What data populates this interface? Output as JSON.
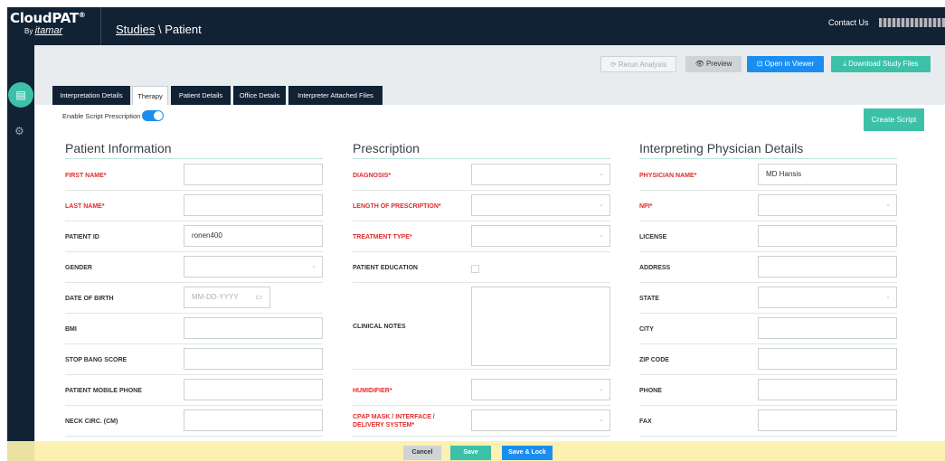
{
  "header": {
    "brand": "CloudPAT",
    "brand_reg": "®",
    "brand_by": "By",
    "brand_company": "itamar",
    "breadcrumb_link": "Studies",
    "breadcrumb_current": " \\ Patient",
    "contact": "Contact Us"
  },
  "actions": {
    "rerun": "⟳ Rerun Analysis",
    "preview": "👁 Preview",
    "open_viewer": "⊡ Open in Viewer",
    "download": "⤓ Download Study Files"
  },
  "tabs": [
    {
      "label": "Interpretation Details",
      "active": false
    },
    {
      "label": "Therapy",
      "active": true
    },
    {
      "label": "Patient Details",
      "active": false
    },
    {
      "label": "Office Details",
      "active": false
    },
    {
      "label": "Interpreter Attached Files",
      "active": false
    }
  ],
  "script": {
    "label": "Enable Script Prescription",
    "enabled": true,
    "create_label": "Create Script"
  },
  "patient": {
    "title": "Patient Information",
    "first_name": {
      "label": "FIRST NAME*",
      "value": ""
    },
    "last_name": {
      "label": "LAST NAME*",
      "value": ""
    },
    "patient_id": {
      "label": "PATIENT ID",
      "value": "ronen400"
    },
    "gender": {
      "label": "GENDER",
      "value": ""
    },
    "dob": {
      "label": "DATE OF BIRTH",
      "placeholder": "MM-DD-YYYY"
    },
    "bmi": {
      "label": "BMI",
      "value": ""
    },
    "stop_bang": {
      "label": "STOP BANG SCORE",
      "value": ""
    },
    "mobile": {
      "label": "PATIENT MOBILE PHONE",
      "value": ""
    },
    "neck": {
      "label": "NECK CIRC. (CM)",
      "value": ""
    }
  },
  "prescription": {
    "title": "Prescription",
    "diagnosis": {
      "label": "DIAGNOSIS*",
      "value": ""
    },
    "length": {
      "label": "LENGTH OF PRESCRIPTION*",
      "value": ""
    },
    "treatment": {
      "label": "TREATMENT TYPE*",
      "value": ""
    },
    "education": {
      "label": "PATIENT EDUCATION",
      "checked": false
    },
    "notes": {
      "label": "CLINICAL NOTES",
      "value": ""
    },
    "humidifier": {
      "label": "HUMIDIFIER*",
      "value": ""
    },
    "cpap_line1": "CPAP MASK / INTERFACE /",
    "cpap_line2": "DELIVERY SYSTEM*"
  },
  "physician": {
    "title": "Interpreting Physician Details",
    "name": {
      "label": "PHYSICIAN NAME*",
      "value": "MD Hansis"
    },
    "npi": {
      "label": "NPI*",
      "value": ""
    },
    "license": {
      "label": "LICENSE",
      "value": ""
    },
    "address": {
      "label": "ADDRESS",
      "value": ""
    },
    "state": {
      "label": "STATE",
      "value": ""
    },
    "city": {
      "label": "CITY",
      "value": ""
    },
    "zip": {
      "label": "ZIP CODE",
      "value": ""
    },
    "phone": {
      "label": "PHONE",
      "value": ""
    },
    "fax": {
      "label": "FAX",
      "value": ""
    }
  },
  "footer": {
    "cancel": "Cancel",
    "save": "Save",
    "save_lock": "Save & Lock"
  },
  "colors": {
    "navy": "#112235",
    "teal": "#3cc1a8",
    "blue": "#1a8ef0",
    "required_red": "#e02b2b",
    "footer_yellow": "#fcf0aa"
  }
}
